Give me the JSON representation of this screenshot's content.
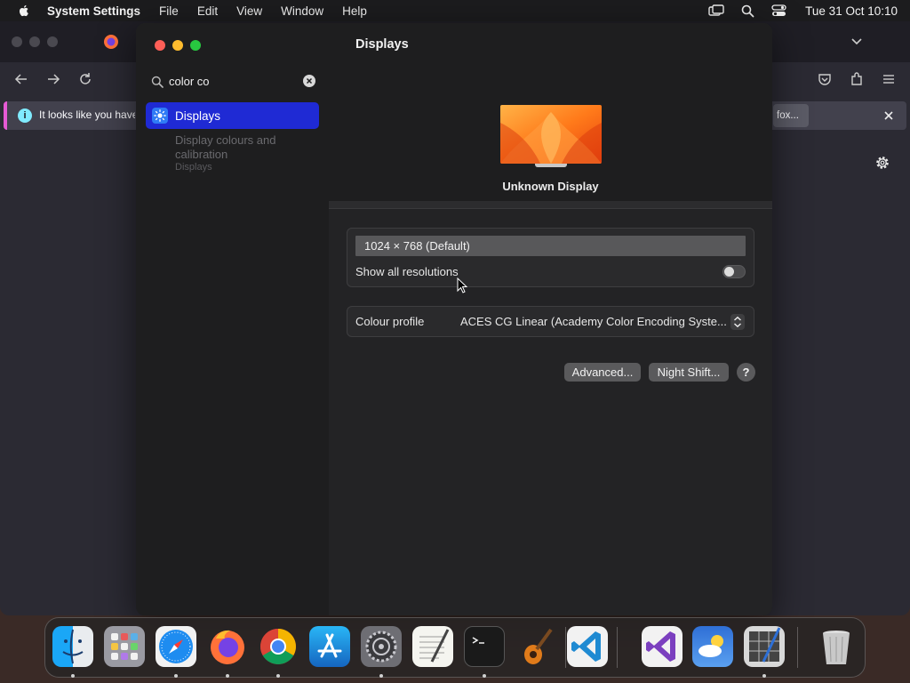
{
  "menubar": {
    "app_name": "System Settings",
    "items": [
      "File",
      "Edit",
      "View",
      "Window",
      "Help"
    ],
    "clock": "Tue 31 Oct  10:10",
    "icons": [
      "screen-mirror-icon",
      "spotlight-icon",
      "control-center-icon"
    ]
  },
  "browser": {
    "notification_text": "It looks like you have",
    "notification_button": "fox..."
  },
  "settings": {
    "search": {
      "value": "color co"
    },
    "sidebar": {
      "active_item": "Displays",
      "result_title": "Display colours and calibration",
      "result_subtitle": "Displays"
    },
    "page_title": "Displays",
    "display_name": "Unknown Display",
    "resolution": "1024 × 768 (Default)",
    "show_all_resolutions_label": "Show all resolutions",
    "show_all_resolutions_on": false,
    "colour_profile_label": "Colour profile",
    "colour_profile_value": "ACES CG Linear (Academy Color Encoding Syste...",
    "advanced_button": "Advanced...",
    "night_shift_button": "Night Shift...",
    "help_button": "?"
  },
  "dock": {
    "apps": [
      "finder",
      "launchpad",
      "safari",
      "firefox",
      "chrome",
      "app-store",
      "system-settings",
      "textedit",
      "terminal",
      "garageband",
      "vscode",
      "visual-studio",
      "weather",
      "script-editor",
      "trash"
    ]
  },
  "colors": {
    "accent_selection": "#1f2ad4",
    "close": "#ff5f57",
    "minimize": "#febc2e",
    "zoom": "#28c840"
  }
}
